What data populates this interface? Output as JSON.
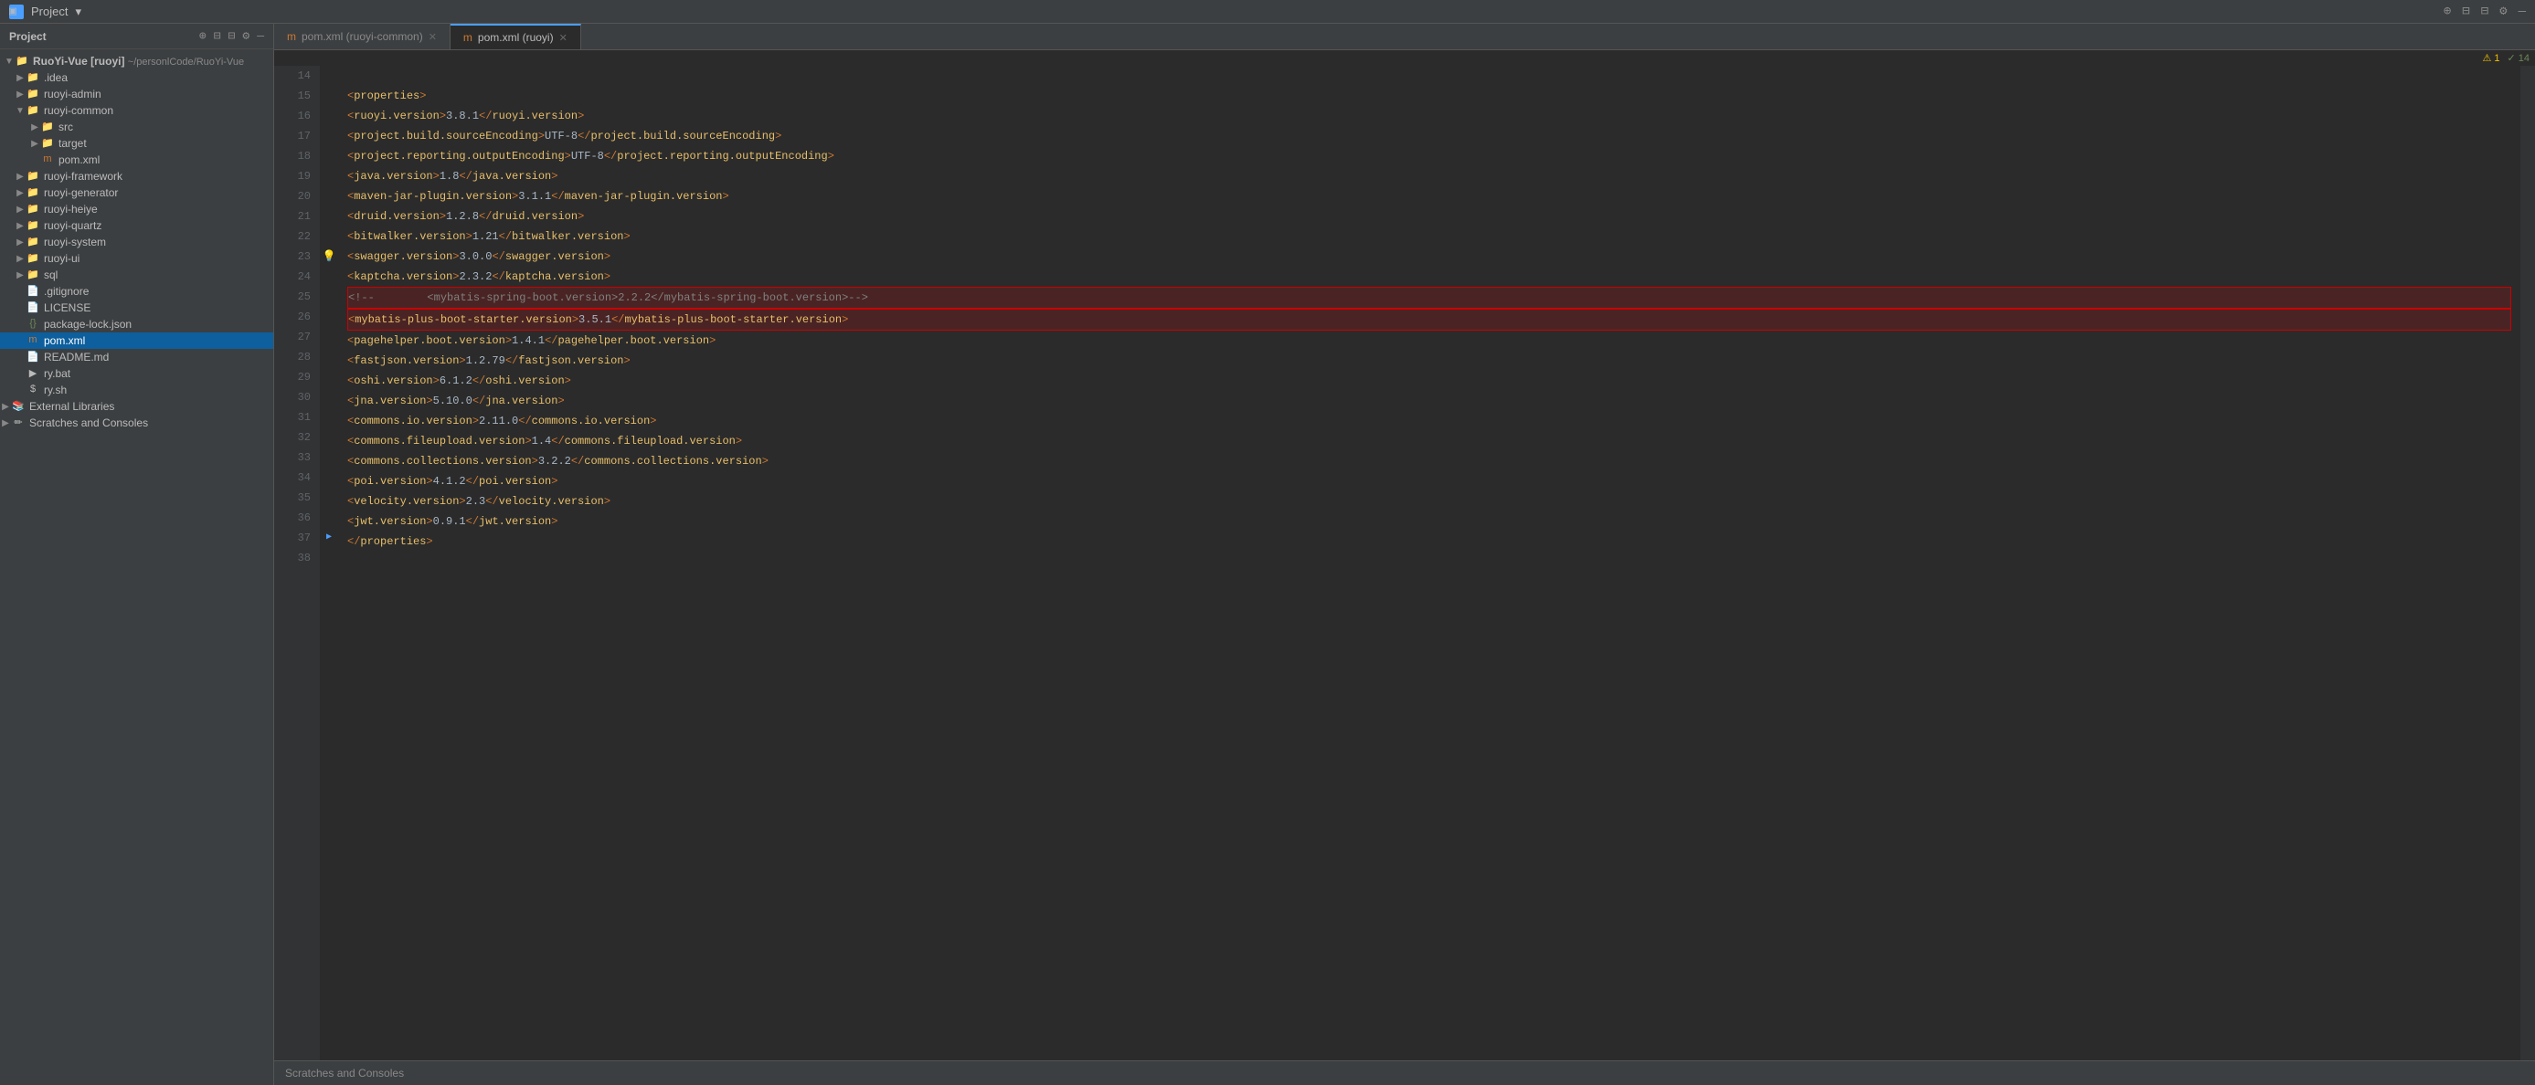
{
  "titleBar": {
    "icon": "▣",
    "title": "Project",
    "actions": [
      "⊕",
      "≡",
      "≡",
      "⚙",
      "—"
    ]
  },
  "sidebar": {
    "title": "Project",
    "rootItem": {
      "label": "RuoYi-Vue [ruoyi]",
      "path": "~/personlCode/RuoYi-Vue"
    },
    "items": [
      {
        "indent": 1,
        "arrow": "▶",
        "icon": "folder",
        "label": ".idea",
        "type": "folder"
      },
      {
        "indent": 1,
        "arrow": "▶",
        "icon": "folder",
        "label": "ruoyi-admin",
        "type": "folder"
      },
      {
        "indent": 1,
        "arrow": "▼",
        "icon": "folder",
        "label": "ruoyi-common",
        "type": "folder",
        "expanded": true
      },
      {
        "indent": 2,
        "arrow": "▶",
        "icon": "folder",
        "label": "src",
        "type": "folder"
      },
      {
        "indent": 2,
        "arrow": "▶",
        "icon": "folder-orange",
        "label": "target",
        "type": "folder-orange"
      },
      {
        "indent": 2,
        "arrow": "",
        "icon": "xml",
        "label": "pom.xml",
        "type": "xml"
      },
      {
        "indent": 1,
        "arrow": "▶",
        "icon": "folder",
        "label": "ruoyi-framework",
        "type": "folder"
      },
      {
        "indent": 1,
        "arrow": "▶",
        "icon": "folder",
        "label": "ruoyi-generator",
        "type": "folder"
      },
      {
        "indent": 1,
        "arrow": "▶",
        "icon": "folder",
        "label": "ruoyi-heiye",
        "type": "folder"
      },
      {
        "indent": 1,
        "arrow": "▶",
        "icon": "folder",
        "label": "ruoyi-quartz",
        "type": "folder"
      },
      {
        "indent": 1,
        "arrow": "▶",
        "icon": "folder",
        "label": "ruoyi-system",
        "type": "folder"
      },
      {
        "indent": 1,
        "arrow": "▶",
        "icon": "folder",
        "label": "ruoyi-ui",
        "type": "folder"
      },
      {
        "indent": 1,
        "arrow": "▶",
        "icon": "folder",
        "label": "sql",
        "type": "folder"
      },
      {
        "indent": 1,
        "arrow": "",
        "icon": "file",
        "label": ".gitignore",
        "type": "file"
      },
      {
        "indent": 1,
        "arrow": "",
        "icon": "file",
        "label": "LICENSE",
        "type": "file"
      },
      {
        "indent": 1,
        "arrow": "",
        "icon": "json",
        "label": "package-lock.json",
        "type": "json"
      },
      {
        "indent": 1,
        "arrow": "",
        "icon": "xml",
        "label": "pom.xml",
        "type": "xml",
        "selected": true
      },
      {
        "indent": 1,
        "arrow": "",
        "icon": "file",
        "label": "README.md",
        "type": "file"
      },
      {
        "indent": 1,
        "arrow": "",
        "icon": "bat",
        "label": "ry.bat",
        "type": "bat"
      },
      {
        "indent": 1,
        "arrow": "",
        "icon": "sh",
        "label": "ry.sh",
        "type": "sh"
      },
      {
        "indent": 0,
        "arrow": "▶",
        "icon": "external",
        "label": "External Libraries",
        "type": "external"
      },
      {
        "indent": 0,
        "arrow": "▶",
        "icon": "scratch",
        "label": "Scratches and Consoles",
        "type": "scratch"
      }
    ]
  },
  "tabs": [
    {
      "icon": "m",
      "label": "pom.xml (ruoyi-common)",
      "active": false,
      "closeable": true
    },
    {
      "icon": "m",
      "label": "pom.xml (ruoyi)",
      "active": true,
      "closeable": true
    }
  ],
  "editorBadges": {
    "warning": "1",
    "check": "14"
  },
  "codeLines": [
    {
      "num": 14,
      "content": "",
      "gutter": ""
    },
    {
      "num": 15,
      "content": "    <properties>",
      "gutter": ""
    },
    {
      "num": 16,
      "content": "        <ruoyi.version>3.8.1</ruoyi.version>",
      "gutter": ""
    },
    {
      "num": 17,
      "content": "        <project.build.sourceEncoding>UTF-8</project.build.sourceEncoding>",
      "gutter": ""
    },
    {
      "num": 18,
      "content": "        <project.reporting.outputEncoding>UTF-8</project.reporting.outputEncoding>",
      "gutter": ""
    },
    {
      "num": 19,
      "content": "        <java.version>1.8</java.version>",
      "gutter": ""
    },
    {
      "num": 20,
      "content": "        <maven-jar-plugin.version>3.1.1</maven-jar-plugin.version>",
      "gutter": ""
    },
    {
      "num": 21,
      "content": "        <druid.version>1.2.8</druid.version>",
      "gutter": ""
    },
    {
      "num": 22,
      "content": "        <bitwalker.version>1.21</bitwalker.version>",
      "gutter": ""
    },
    {
      "num": 23,
      "content": "        <swagger.version>3.0.0</swagger.version>",
      "gutter": "warn"
    },
    {
      "num": 24,
      "content": "        <kaptcha.version>2.3.2</kaptcha.version>",
      "gutter": ""
    },
    {
      "num": 25,
      "content": "<!--        <mybatis-spring-boot.version>2.2.2</mybatis-spring-boot.version>-->",
      "gutter": "",
      "highlighted": true,
      "isComment": true
    },
    {
      "num": 26,
      "content": "        <mybatis-plus-boot-starter.version>3.5.1</mybatis-plus-boot-starter.version>",
      "gutter": "",
      "highlighted": true
    },
    {
      "num": 27,
      "content": "        <pagehelper.boot.version>1.4.1</pagehelper.boot.version>",
      "gutter": ""
    },
    {
      "num": 28,
      "content": "        <fastjson.version>1.2.79</fastjson.version>",
      "gutter": ""
    },
    {
      "num": 29,
      "content": "        <oshi.version>6.1.2</oshi.version>",
      "gutter": ""
    },
    {
      "num": 30,
      "content": "        <jna.version>5.10.0</jna.version>",
      "gutter": ""
    },
    {
      "num": 31,
      "content": "        <commons.io.version>2.11.0</commons.io.version>",
      "gutter": ""
    },
    {
      "num": 32,
      "content": "        <commons.fileupload.version>1.4</commons.fileupload.version>",
      "gutter": ""
    },
    {
      "num": 33,
      "content": "        <commons.collections.version>3.2.2</commons.collections.version>",
      "gutter": ""
    },
    {
      "num": 34,
      "content": "        <poi.version>4.1.2</poi.version>",
      "gutter": ""
    },
    {
      "num": 35,
      "content": "        <velocity.version>2.3</velocity.version>",
      "gutter": ""
    },
    {
      "num": 36,
      "content": "        <jwt.version>0.9.1</jwt.version>",
      "gutter": ""
    },
    {
      "num": 37,
      "content": "    </properties>",
      "gutter": "marker"
    },
    {
      "num": 38,
      "content": "",
      "gutter": ""
    }
  ]
}
